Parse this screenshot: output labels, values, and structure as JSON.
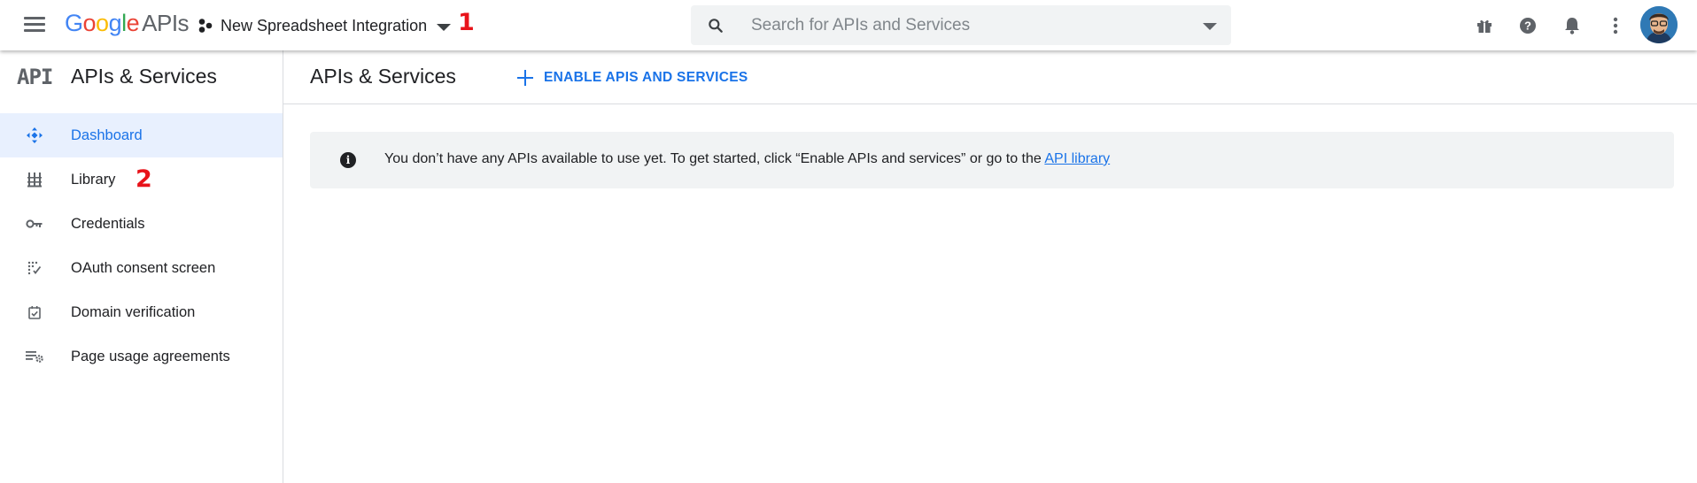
{
  "topbar": {
    "logo_google": [
      "G",
      "o",
      "o",
      "g",
      "l",
      "e"
    ],
    "logo_colors": [
      "#4285F4",
      "#EA4335",
      "#FBBC05",
      "#4285F4",
      "#34A853",
      "#EA4335"
    ],
    "logo_apis": "APIs",
    "project_name": "New Spreadsheet Integration",
    "annotation_1": "1",
    "search_placeholder": "Search for APIs and Services",
    "icons": [
      "gift-icon",
      "help-icon",
      "notifications-icon",
      "more-vert-icon"
    ]
  },
  "sidebar": {
    "icon_text": "API",
    "title": "APIs & Services",
    "items": [
      {
        "label": "Dashboard",
        "icon": "dashboard-icon",
        "active": true
      },
      {
        "label": "Library",
        "icon": "library-icon",
        "active": false
      },
      {
        "label": "Credentials",
        "icon": "key-icon",
        "active": false
      },
      {
        "label": "OAuth consent screen",
        "icon": "consent-icon",
        "active": false
      },
      {
        "label": "Domain verification",
        "icon": "checkbox-icon",
        "active": false
      },
      {
        "label": "Page usage agreements",
        "icon": "settings-list-icon",
        "active": false
      }
    ],
    "annotation_2": "2"
  },
  "main": {
    "title": "APIs & Services",
    "enable_button": "ENABLE APIS AND SERVICES",
    "notice_text": "You don’t have any APIs available to use yet. To get started, click “Enable APIs and services” or go to the ",
    "notice_link": "API library"
  },
  "colors": {
    "accent": "#1a73e8",
    "annotation": "#e8131a",
    "active_bg": "#e8f0fe"
  }
}
